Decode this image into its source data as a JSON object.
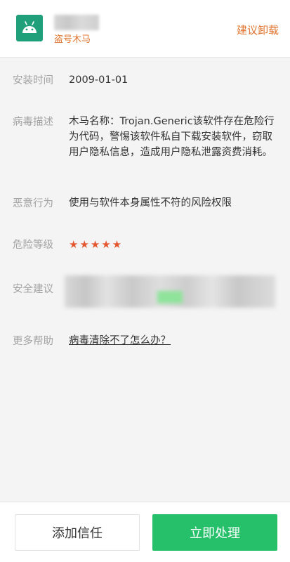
{
  "header": {
    "app_tag": "盗号木马",
    "uninstall_label": "建议卸载",
    "icon_color": "#1fa07a"
  },
  "details": {
    "install_time": {
      "label": "安装时间",
      "value": "2009-01-01"
    },
    "virus_desc": {
      "label": "病毒描述",
      "value": "木马名称：Trojan.Generic该软件存在危险行为代码，警惕该软件私自下载安装软件，窃取用户隐私信息，造成用户隐私泄露资费消耗。"
    },
    "malicious_behavior": {
      "label": "恶意行为",
      "value": "使用与软件本身属性不符的风险权限"
    },
    "risk_level": {
      "label": "危险等级",
      "stars": "★★★★★",
      "star_color": "#e4572e"
    },
    "security_advice": {
      "label": "安全建议"
    },
    "more_help": {
      "label": "更多帮助",
      "link": "病毒清除不了怎么办？"
    }
  },
  "footer": {
    "trust_label": "添加信任",
    "handle_label": "立即处理",
    "accent_color": "#27c06a"
  }
}
